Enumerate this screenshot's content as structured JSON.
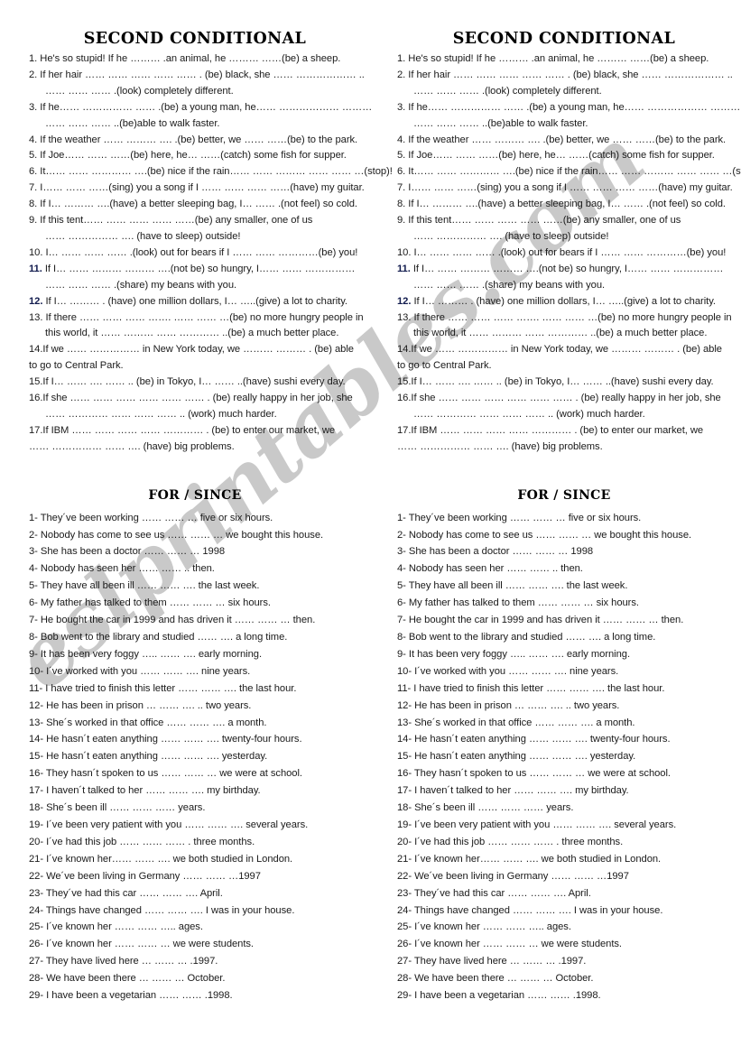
{
  "watermark": {
    "text": "eslprintables.com",
    "color": "#c9c9c9"
  },
  "worksheet": {
    "conditional": {
      "title": "SECOND CONDITIONAL",
      "items": [
        {
          "indent": false,
          "highlight": false,
          "text": "1. He's so stupid! If he ……… .an animal, he ……… ……(be) a sheep."
        },
        {
          "indent": false,
          "highlight": false,
          "text": "2. If her hair …… …… …… …… …… . (be) black, she …… ……………… .."
        },
        {
          "indent": true,
          "highlight": false,
          "text": "…… …… …… .(look) completely different."
        },
        {
          "indent": false,
          "highlight": false,
          "text": "3. If he…… …………… …… .(be) a young man, he…… ……………… ………"
        },
        {
          "indent": true,
          "highlight": false,
          "text": "…… …… …… ..(be)able to walk faster."
        },
        {
          "indent": false,
          "highlight": false,
          "text": "4. If the weather …… ……… …. .(be) better, we …… ……(be) to the park."
        },
        {
          "indent": false,
          "highlight": false,
          "text": "5. If Joe…… …… ……(be) here, he… ……(catch) some fish for supper."
        },
        {
          "indent": false,
          "highlight": false,
          "text": "6. It…… …… ………… ….(be) nice if the rain…… …… ……… …… …… …(stop)!"
        },
        {
          "indent": false,
          "highlight": false,
          "text": "7. I…… …… ……(sing) you a song if I …… …… …… ……(have) my guitar."
        },
        {
          "indent": false,
          "highlight": false,
          "text": "8. If I… ……… ….(have) a better sleeping bag, I… …… .(not feel) so cold."
        },
        {
          "indent": false,
          "highlight": false,
          "text": "9. If this tent…… …… …… …… ……(be) any smaller, one of us"
        },
        {
          "indent": true,
          "highlight": false,
          "text": "…… …………… …. (have to sleep) outside!"
        },
        {
          "indent": false,
          "highlight": false,
          "text": "10.   I… …… …… …… .(look) out for bears if I …… …… …………(be) you!"
        },
        {
          "indent": false,
          "highlight": true,
          "number": "11.",
          "text": "  If I… …… ……… ……… ….(not be) so hungry, I…… …… ……………"
        },
        {
          "indent": true,
          "highlight": false,
          "text": "…… …… …… .(share) my beans with you."
        },
        {
          "indent": false,
          "highlight": true,
          "number": "12.",
          "text": "  If I… ……… . (have) one million dollars, I… …..(give) a lot to charity."
        },
        {
          "indent": false,
          "highlight": false,
          "text": "13. If there …… …… …… ……. …… …… …(be) no more hungry people in"
        },
        {
          "indent": true,
          "highlight": false,
          "text": "this world, it …… ……… …… ………… ..(be) a much better place."
        },
        {
          "indent": false,
          "highlight": false,
          "text": "14.If we …… ……………   in New York today, we ……… ……… . (be) able"
        },
        {
          "indent": false,
          "highlight": false,
          "text": "to go to Central Park."
        },
        {
          "indent": false,
          "highlight": false,
          "text": "15.If I… …… …. …… ..  (be) in Tokyo, I… …… ..(have) sushi every day."
        },
        {
          "indent": false,
          "highlight": false,
          "text": "16.If she …… …… …… …… …… …… . (be) really happy in her job, she"
        },
        {
          "indent": true,
          "highlight": false,
          "text": "…… ………… …… …… …… .. (work) much harder."
        },
        {
          "indent": false,
          "highlight": false,
          "text": "17.If IBM …… …… …… …… ………… . (be) to enter our market, we"
        },
        {
          "indent": false,
          "highlight": false,
          "text": "…… …………… …… …. (have) big problems."
        }
      ]
    },
    "for_since": {
      "title": "FOR / SINCE",
      "items": [
        "1- They´ve been working …… …… … five or six hours.",
        "2- Nobody has come to see us …… …… … we bought this house.",
        "3- She has been a doctor …… …… … 1998",
        "4- Nobody has seen her  …… …… ..  then.",
        "5- They have all been ill   …… …… ….  the last week.",
        "6- My father has talked to them …… …… …   six hours.",
        "7- He bought the car in 1999 and has driven it   …… …… …  then.",
        "8- Bob went to the library and studied …… ….  a long time.",
        "9- It has been very foggy   ….. …… ….   early morning.",
        "10- I´ve worked with you   …… …… ….  nine years.",
        "11- I have tried to finish this letter   …… …… ….  the last hour.",
        "12- He has been in prison … …… …. ..  two years.",
        "13- She´s worked in that office   …… …… ….  a month.",
        "14- He hasn´t eaten anything   …… …… ….  twenty-four hours.",
        "15- He hasn´t eaten anything   …… …… ….  yesterday.",
        "16- They hasn´t spoken to us   …… …… …  we were at school.",
        "17- I haven´t talked to her   …… …… ….  my birthday.",
        "18- She´s been ill …… …… ……   years.",
        "19- I´ve been very patient with you …… …… ….  several years.",
        "20- I´ve had this job …… …… …… .   three months.",
        "21- I´ve known her…… …… ….   we both studied in London.",
        "22- We´ve been living in Germany …… …… …1997",
        "23- They´ve had this car …… …… ….   April.",
        "24- Things have changed   …… …… ….   I was in your house.",
        "25- I´ve known her   …… …… …..   ages.",
        "26- I´ve known her   …… …… …  we were students.",
        "27- They have lived here … …… … .1997.",
        "28- We have been there   … …… …   October.",
        "29- I have been a vegetarian …… …… .1998."
      ]
    }
  }
}
